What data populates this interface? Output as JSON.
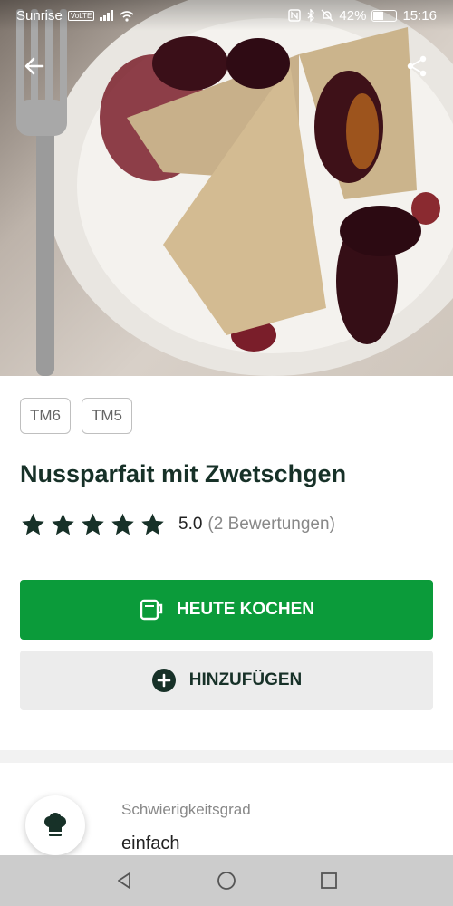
{
  "status_bar": {
    "carrier": "Sunrise",
    "volte": "VoLTE",
    "battery": "42%",
    "time": "15:16"
  },
  "header": {
    "back_icon": "arrow-left-icon",
    "share_icon": "share-icon"
  },
  "recipe": {
    "tags": [
      "TM6",
      "TM5"
    ],
    "title": "Nussparfait mit Zwetschgen",
    "rating_value": "5.0",
    "rating_count": "(2 Bewertungen)",
    "stars": 5
  },
  "actions": {
    "cook_label": "HEUTE KOCHEN",
    "add_label": "HINZUFÜGEN"
  },
  "details": {
    "difficulty_label": "Schwierigkeitsgrad",
    "difficulty_value": "einfach"
  },
  "colors": {
    "primary_green": "#0b9b3a",
    "dark_green": "#173128"
  }
}
